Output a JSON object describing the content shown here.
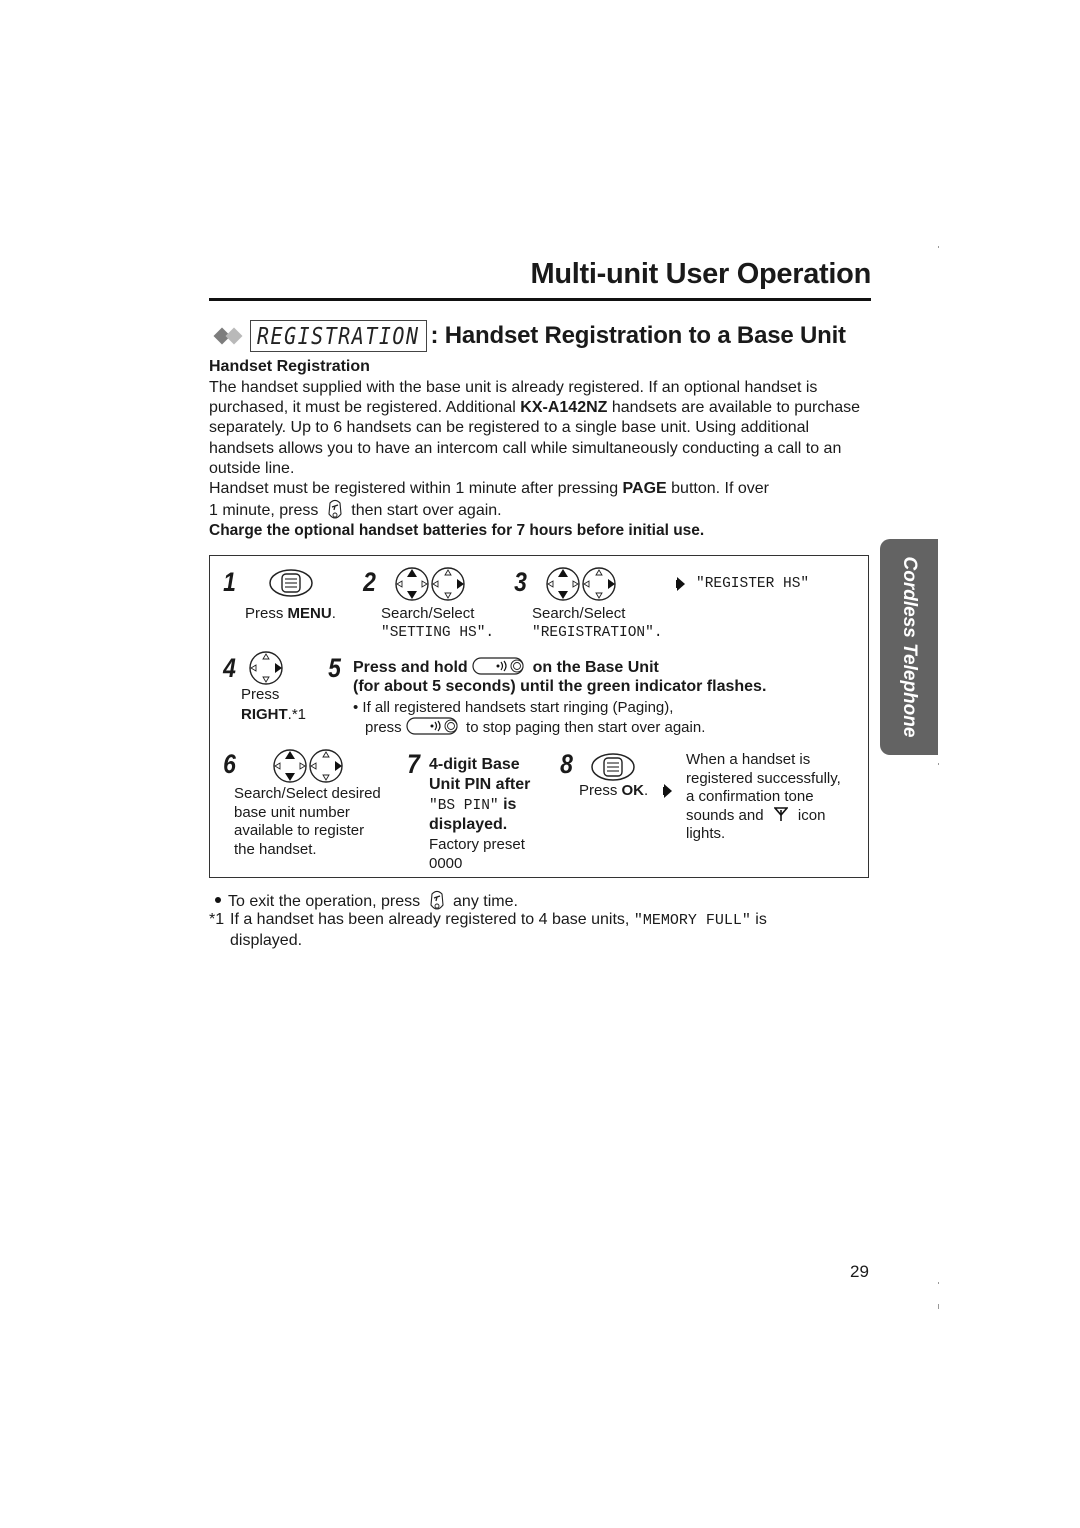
{
  "header": {
    "page_title": "Multi-unit User Operation"
  },
  "section": {
    "lcd_label": "REGISTRATION",
    "title": ": Handset Registration to a Base Unit",
    "subheading": "Handset Registration",
    "paragraph1_a": "The handset supplied with the base unit is already registered. If an optional handset is purchased, it must be registered. Additional ",
    "paragraph1_model": "KX-A142NZ",
    "paragraph1_b": " handsets are available to purchase separately. Up to 6 handsets can be registered to a single base unit. Using additional handsets allows you to have an intercom call while simultaneously conducting a call to an outside line.",
    "paragraph2_a": "Handset must be registered within 1 minute after pressing ",
    "paragraph2_page": "PAGE",
    "paragraph2_b": " button. If over",
    "paragraph2_c": "1 minute, press",
    "paragraph2_d": "then start over again.",
    "charge_note": "Charge the optional handset batteries for 7 hours before initial use."
  },
  "steps": {
    "s1": {
      "num": "1",
      "press": "Press ",
      "key": "MENU",
      "end": "."
    },
    "s2": {
      "num": "2",
      "action": "Search/Select",
      "display": "\"SETTING HS\"."
    },
    "s3": {
      "num": "3",
      "action": "Search/Select",
      "display": "\"REGISTRATION\".",
      "result": "\"REGISTER HS\""
    },
    "s4": {
      "num": "4",
      "press": "Press",
      "key": "RIGHT",
      "note": ".*1"
    },
    "s5": {
      "num": "5",
      "line1_a": "Press and hold",
      "line1_b": "on the Base Unit",
      "line2": "(for about 5 seconds) until the green indicator flashes.",
      "bullet_a": "• If all registered handsets start ringing (Paging),",
      "bullet_b1": "press",
      "bullet_b2": "to stop paging then start over again."
    },
    "s6": {
      "num": "6",
      "text": [
        "Search/Select desired",
        "base unit number",
        "available to register",
        "the handset."
      ]
    },
    "s7": {
      "num": "7",
      "line1": "4-digit Base",
      "line2": "Unit PIN after",
      "display": "\"BS PIN\"",
      "line3_end": " is",
      "line4": "displayed.",
      "preset_label": "Factory preset",
      "preset_value": "0000"
    },
    "s8": {
      "num": "8",
      "press": "Press ",
      "key": "OK",
      "end": ".",
      "result": [
        "When a handset is",
        "registered successfully,",
        "a confirmation tone",
        "sounds and",
        "icon",
        "lights."
      ]
    }
  },
  "footnotes": {
    "exit_a": "To exit the operation, press",
    "exit_b": "any time.",
    "note_marker": "*1",
    "note_a": "If a handset has been already registered to 4 base units, ",
    "note_display": "\"MEMORY FULL\"",
    "note_b": " is",
    "note_c": "displayed."
  },
  "side_tab": {
    "label": "Cordless Telephone"
  },
  "page_number": "29",
  "icons": {
    "menu_button": "menu-button-icon",
    "navigator_up_down": "navigator-up-down-icon",
    "navigator_right": "navigator-right-icon",
    "page_button": "page-button-icon",
    "off_button": "off-button-icon",
    "result_arrow": "arrow-right-icon",
    "antenna": "antenna-icon"
  }
}
